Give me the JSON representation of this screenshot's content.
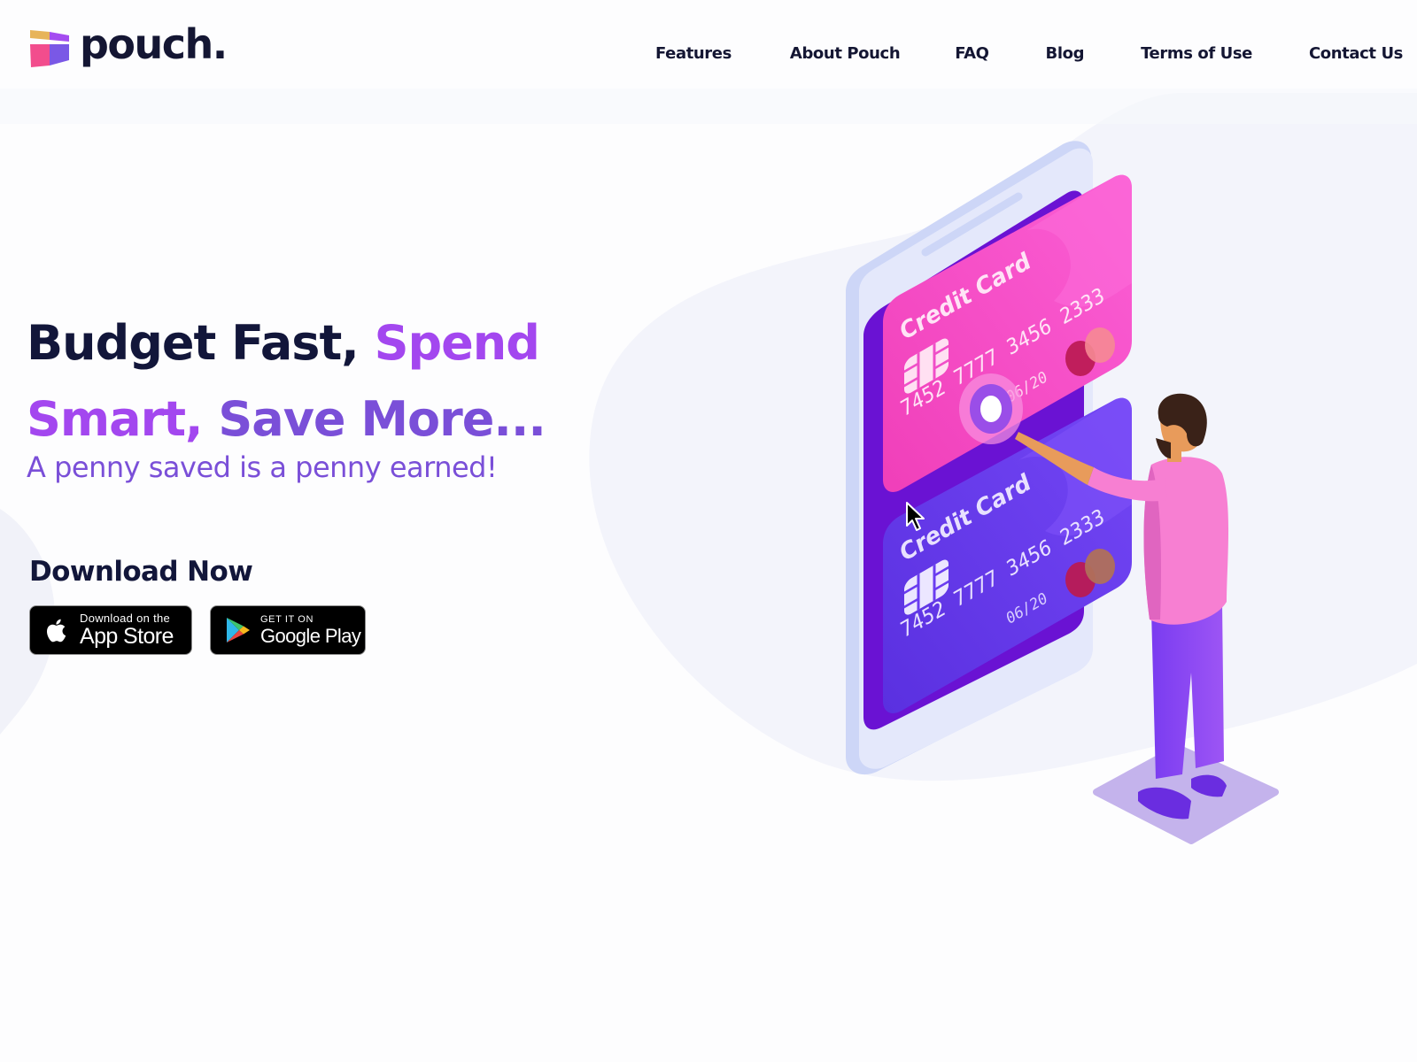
{
  "header": {
    "logo_text": "pouch.",
    "nav": [
      {
        "label": "Features"
      },
      {
        "label": "About Pouch"
      },
      {
        "label": "FAQ"
      },
      {
        "label": "Blog"
      },
      {
        "label": "Terms of Use"
      },
      {
        "label": "Contact Us"
      }
    ]
  },
  "hero": {
    "headline_line1_a": "Budget Fast, ",
    "headline_line1_b": "Spend",
    "headline_line2_a": "Smart, ",
    "headline_line2_b": "Save More...",
    "tagline": "A penny saved is a penny earned!"
  },
  "download": {
    "title": "Download Now",
    "app_store": {
      "small": "Download on the",
      "large": "App Store",
      "icon": "apple-icon"
    },
    "google_play": {
      "small": "GET IT ON",
      "large": "Google Play",
      "icon": "google-play-icon"
    }
  },
  "illustration": {
    "cards": [
      {
        "title": "Credit Card",
        "number": "7452 7777 3456 2333",
        "expiry": "06/20",
        "color": "#f04fc8"
      },
      {
        "title": "Credit Card",
        "number": "7452 7777 3456 2333",
        "expiry": "06/20",
        "color": "#6a3cf0"
      }
    ]
  },
  "colors": {
    "brand_dark": "#12163a",
    "accent_violet": "#a347ef",
    "accent_indigo": "#7a4fd8",
    "card_pink": "#f04fc8",
    "card_purple": "#6a3cf0",
    "phone_frame": "#dfe4fb"
  }
}
